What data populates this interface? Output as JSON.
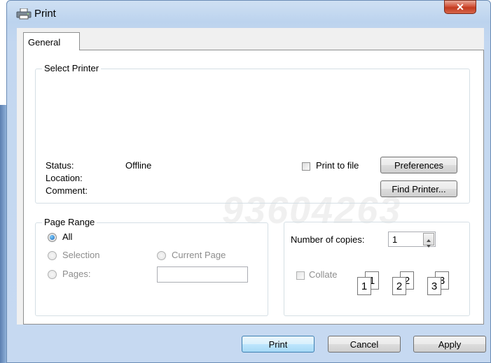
{
  "window": {
    "title": "Print",
    "close_glyph": "✕"
  },
  "tabs": [
    {
      "label": "General"
    }
  ],
  "select_printer": {
    "label": "Select Printer",
    "status_label": "Status:",
    "status_value": "Offline",
    "location_label": "Location:",
    "comment_label": "Comment:",
    "print_to_file_label": "Print to file",
    "print_to_file_checked": false,
    "preferences_button": "Preferences",
    "find_printer_button": "Find Printer..."
  },
  "page_range": {
    "label": "Page Range",
    "all_label": "All",
    "selection_label": "Selection",
    "current_page_label": "Current Page",
    "pages_label": "Pages:",
    "pages_value": "",
    "selected": "All"
  },
  "copies": {
    "number_of_copies_label": "Number of copies:",
    "copies_value": "1",
    "collate_label": "Collate",
    "collate_checked": false,
    "collate_pages": [
      "1",
      "1",
      "2",
      "2",
      "3",
      "3"
    ]
  },
  "watermark_text": "93604263",
  "buttons": {
    "print": "Print",
    "cancel": "Cancel",
    "apply": "Apply"
  },
  "icons": {
    "printer": "printer-icon"
  },
  "colors": {
    "title_bar": "#c3d7f0",
    "close_button": "#c23a1f",
    "panel": "#ffffff",
    "client": "#f0f0f0"
  }
}
